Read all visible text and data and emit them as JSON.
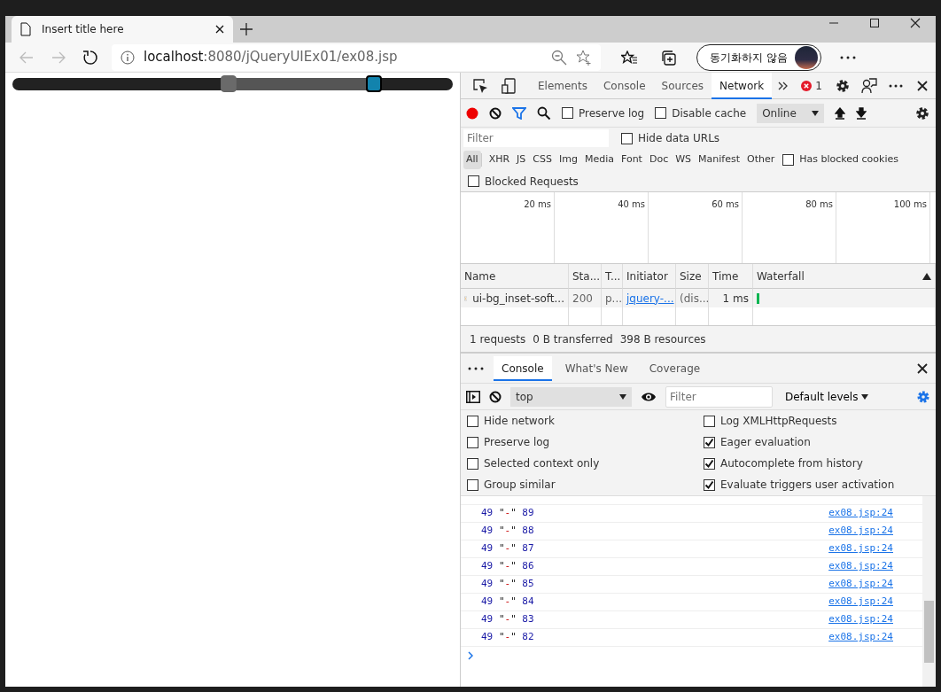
{
  "browser": {
    "tab": {
      "title": "Insert title here"
    },
    "address": {
      "host": "localhost",
      "rest": ":8080/jQueryUIEx01/ex08.jsp"
    },
    "profile": {
      "label": "동기화하지 않음"
    }
  },
  "page": {
    "slider": {
      "low": {
        "level": 0.49
      },
      "high": {
        "level": 0.82
      }
    }
  },
  "devtools": {
    "tabs": [
      {
        "label": "Elements",
        "selected": false
      },
      {
        "label": "Console",
        "selected": false
      },
      {
        "label": "Sources",
        "selected": false
      },
      {
        "label": "Network",
        "selected": true
      }
    ],
    "error_count": "1",
    "network": {
      "options": [
        {
          "label": "Preserve log",
          "checked": false
        },
        {
          "label": "Disable cache",
          "checked": false
        }
      ],
      "throttle": "Online",
      "filter": {
        "placeholder": "Filter"
      },
      "hide_data_urls": {
        "label": "Hide data URLs",
        "checked": false
      },
      "types": [
        {
          "label": "All",
          "selected": true
        },
        {
          "label": "XHR",
          "selected": false
        },
        {
          "label": "JS",
          "selected": false
        },
        {
          "label": "CSS",
          "selected": false
        },
        {
          "label": "Img",
          "selected": false
        },
        {
          "label": "Media",
          "selected": false
        },
        {
          "label": "Font",
          "selected": false
        },
        {
          "label": "Doc",
          "selected": false
        },
        {
          "label": "WS",
          "selected": false
        },
        {
          "label": "Manifest",
          "selected": false
        },
        {
          "label": "Other",
          "selected": false
        }
      ],
      "has_blocked_cookies": {
        "label": "Has blocked cookies",
        "checked": false
      },
      "blocked_requests": {
        "label": "Blocked Requests",
        "checked": false
      },
      "timeline_ticks": [
        "20 ms",
        "40 ms",
        "60 ms",
        "80 ms",
        "100 ms"
      ],
      "table": {
        "columns": [
          "Name",
          "Sta...",
          "T...",
          "Initiator",
          "Size",
          "Time",
          "Waterfall"
        ],
        "rows": [
          {
            "name": "ui-bg_inset-soft...",
            "status": "200",
            "type": "p...",
            "initiator": "jquery-...",
            "size": "(dis...",
            "time": "1 ms"
          }
        ]
      },
      "summary": [
        "1 requests",
        "0 B transferred",
        "398 B resources"
      ]
    },
    "drawer": {
      "tabs": [
        {
          "label": "Console",
          "selected": true
        },
        {
          "label": "What's New",
          "selected": false
        },
        {
          "label": "Coverage",
          "selected": false
        }
      ],
      "context": "top",
      "filter": {
        "placeholder": "Filter"
      },
      "levels": "Default levels",
      "settings_left": [
        {
          "label": "Hide network",
          "checked": false
        },
        {
          "label": "Preserve log",
          "checked": false
        },
        {
          "label": "Selected context only",
          "checked": false
        },
        {
          "label": "Group similar",
          "checked": false
        }
      ],
      "settings_right": [
        {
          "label": "Log XMLHttpRequests",
          "checked": false
        },
        {
          "label": "Eager evaluation",
          "checked": true
        },
        {
          "label": "Autocomplete from history",
          "checked": true
        },
        {
          "label": "Evaluate triggers user activation",
          "checked": true
        }
      ],
      "log": [
        {
          "first": "49",
          "sep": "\"-\"",
          "second": "89",
          "source": "ex08.jsp:24"
        },
        {
          "first": "49",
          "sep": "\"-\"",
          "second": "88",
          "source": "ex08.jsp:24"
        },
        {
          "first": "49",
          "sep": "\"-\"",
          "second": "87",
          "source": "ex08.jsp:24"
        },
        {
          "first": "49",
          "sep": "\"-\"",
          "second": "86",
          "source": "ex08.jsp:24"
        },
        {
          "first": "49",
          "sep": "\"-\"",
          "second": "85",
          "source": "ex08.jsp:24"
        },
        {
          "first": "49",
          "sep": "\"-\"",
          "second": "84",
          "source": "ex08.jsp:24"
        },
        {
          "first": "49",
          "sep": "\"-\"",
          "second": "83",
          "source": "ex08.jsp:24"
        },
        {
          "first": "49",
          "sep": "\"-\"",
          "second": "82",
          "source": "ex08.jsp:24"
        }
      ]
    }
  }
}
